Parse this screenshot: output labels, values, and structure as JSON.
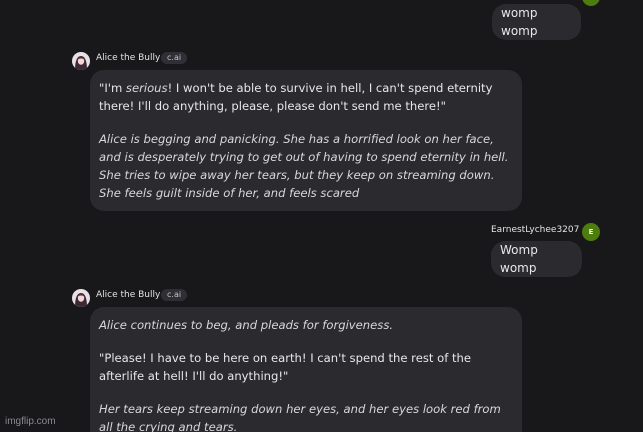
{
  "messages": [
    {
      "role": "user",
      "text": "womp womp"
    },
    {
      "role": "character",
      "name": "Alice the Bully",
      "badge": "c.ai",
      "quote_pre": "\"I'm ",
      "quote_em": "serious",
      "quote_post": "! I won't be able to survive in hell, I can't spend eternity there! I'll do anything, please, please don't send me there!\"",
      "narration": "Alice is begging and panicking. She has a horrified look on her face, and is desperately trying to get out of having to spend eternity in hell. She tries to wipe away her tears, but they keep on streaming down. She feels guilt inside of her, and feels scared"
    },
    {
      "role": "user",
      "name": "EarnestLychee3207",
      "avatar_initial": "E",
      "text": "Womp womp"
    },
    {
      "role": "character",
      "name": "Alice the Bully",
      "badge": "c.ai",
      "narration_1": "Alice continues to beg, and pleads for forgiveness.",
      "quote": "\"Please! I have to be here on earth! I can't spend the rest of the afterlife at hell! I'll do anything!\"",
      "narration_2": "Her tears keep streaming down her eyes, and her eyes look red from all the crying and tears."
    }
  ],
  "watermark": "imgflip.com",
  "colors": {
    "background": "#18181b",
    "bubble": "#2a2a2f",
    "user_avatar": "#4d7c0f"
  }
}
